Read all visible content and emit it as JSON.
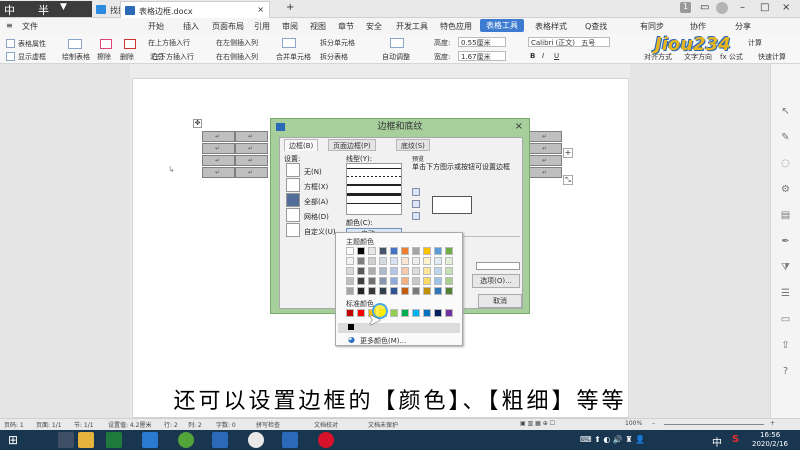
{
  "tabbar": {
    "ime_zh": "中",
    "ime_mode": "半",
    "tabs": [
      {
        "label": "找找模板",
        "active": false
      },
      {
        "label": "表格边框.docx",
        "active": true
      }
    ],
    "new_tab": "+",
    "badge": "1"
  },
  "menu": {
    "file": "文件",
    "items": [
      "开始",
      "插入",
      "页面布局",
      "引用",
      "审阅",
      "视图",
      "章节",
      "安全",
      "开发工具",
      "特色应用",
      "表格工具",
      "表格样式"
    ],
    "active": "表格工具",
    "search": "Q查找",
    "sync": "有同步",
    "share": "协作",
    "share2": "分享"
  },
  "toolbar": {
    "table_props": "表格属性",
    "show_grid": "显示虚框",
    "draw_table": "绘制表格",
    "eraser": "擦除",
    "delete": "删除",
    "summary": "汇总",
    "insert_above": "在上方插入行",
    "insert_below": "在下方插入行",
    "insert_left": "在左侧插入列",
    "insert_right": "在右侧插入列",
    "merge": "合并单元格",
    "split_cell": "拆分单元格",
    "split_table": "拆分表格",
    "autofit": "自动调整",
    "height_label": "高度:",
    "height_value": "0.55厘米",
    "width_label": "宽度:",
    "width_value": "1.67厘米",
    "font_name": "Calibri (正文)",
    "font_size": "五号",
    "align": "对齐方式",
    "text_dir": "文字方向",
    "calc": "计算",
    "formula": "fx 公式",
    "convert": "快速计算"
  },
  "table": {
    "cell_mark": "↵"
  },
  "dialog": {
    "title": "边框和底纹",
    "tabs": [
      "边框(B)",
      "页面边框(P)",
      "底纹(S)"
    ],
    "settings_label": "设置:",
    "settings": [
      "无(N)",
      "方框(X)",
      "全部(A)",
      "网格(D)",
      "自定义(U)"
    ],
    "style_label": "线型(Y):",
    "preview_label": "预览",
    "preview_hint": "单击下方图示或按钮可设置边框",
    "color_label": "颜色(C):",
    "color_value": "自动",
    "options_button": "选项(O)...",
    "cancel_button": "取消"
  },
  "palette": {
    "theme_label": "主题颜色",
    "standard_label": "标准颜色",
    "more_colors": "更多颜色(M)...",
    "theme_colors": [
      [
        "#ffffff",
        "#000000",
        "#e7e6e6",
        "#44546a",
        "#4472c4",
        "#ed7d31",
        "#a5a5a5",
        "#ffc000",
        "#5b9bd5",
        "#70ad47"
      ],
      [
        "#f2f2f2",
        "#7f7f7f",
        "#d0cece",
        "#d6dce4",
        "#d9e2f3",
        "#fbe5d5",
        "#ededed",
        "#fff2cc",
        "#deebf6",
        "#e2efd9"
      ],
      [
        "#d8d8d8",
        "#595959",
        "#aeabab",
        "#adb9ca",
        "#b4c6e7",
        "#f7cbac",
        "#dbdbdb",
        "#fee599",
        "#bdd7ee",
        "#c5e0b3"
      ],
      [
        "#bfbfbf",
        "#3f3f3f",
        "#757070",
        "#8496b0",
        "#8eaadb",
        "#f4b183",
        "#c9c9c9",
        "#ffd965",
        "#9cc3e5",
        "#a8d08d"
      ],
      [
        "#a5a5a5",
        "#262626",
        "#3a3838",
        "#323f4f",
        "#2f5496",
        "#c55a11",
        "#7b7b7b",
        "#bf9000",
        "#2e75b5",
        "#538135"
      ]
    ],
    "standard_colors": [
      "#c00000",
      "#ff0000",
      "#ffc000",
      "#ffff00",
      "#92d050",
      "#00b050",
      "#00b0f0",
      "#0070c0",
      "#002060",
      "#7030a0"
    ]
  },
  "subtitle": "还可以设置边框的【颜色】、【粗细】等等",
  "status": {
    "page": "页码: 1",
    "pages": "页面: 1/1",
    "section": "节: 1/1",
    "position": "设置值: 4.2厘米",
    "row": "行: 2",
    "col": "列: 2",
    "words": "字数: 0",
    "spell": "拼写检查",
    "proof": "文档校对",
    "protect": "文档未保护",
    "zoom": "100%"
  },
  "taskbar": {
    "lang": "中",
    "input": "S",
    "time": "16:56",
    "date": "2020/2/16"
  },
  "watermark": "Jiou234"
}
